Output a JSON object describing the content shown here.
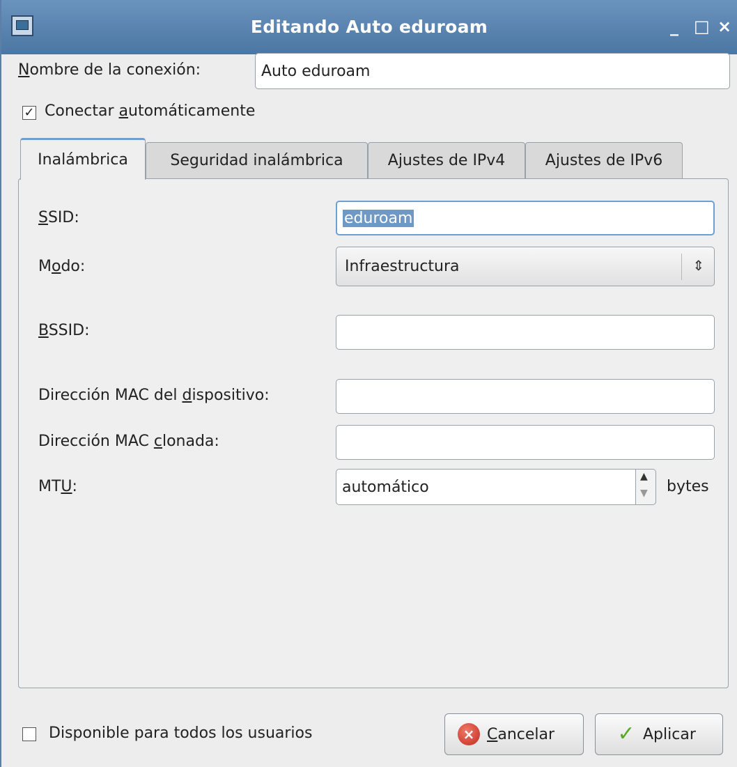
{
  "window": {
    "title": "Editando Auto eduroam",
    "minimize": "_",
    "maximize": "□",
    "close": "×"
  },
  "connection_name": {
    "label_mnemonic": "N",
    "label_rest": "ombre de la conexión:",
    "value": "Auto eduroam"
  },
  "auto_connect": {
    "checked": "✓",
    "label_pre": "Conectar ",
    "label_mnemonic": "a",
    "label_post": "utomáticamente"
  },
  "tabs": [
    {
      "label": "Inalámbrica"
    },
    {
      "label": "Seguridad inalámbrica"
    },
    {
      "label": "Ajustes de IPv4"
    },
    {
      "label": "Ajustes de IPv6"
    }
  ],
  "wireless": {
    "ssid": {
      "label_mnemonic": "S",
      "label_rest": "SID:",
      "value": "eduroam"
    },
    "mode": {
      "label_pre": "M",
      "label_mnemonic": "o",
      "label_post": "do:",
      "value": "Infraestructura"
    },
    "bssid": {
      "label_mnemonic": "B",
      "label_rest": "SSID:",
      "value": ""
    },
    "mac": {
      "label_pre": "Dirección MAC del ",
      "label_mnemonic": "d",
      "label_post": "ispositivo:",
      "value": ""
    },
    "cloned_mac": {
      "label_pre": "Dirección MAC ",
      "label_mnemonic": "c",
      "label_post": "lonada:",
      "value": ""
    },
    "mtu": {
      "label_pre": "MT",
      "label_mnemonic": "U",
      "label_post": ":",
      "value": "automático",
      "unit": "bytes"
    }
  },
  "footer": {
    "all_users_label": "Disponible para todos los usuarios",
    "cancel_mnemonic": "C",
    "cancel_rest": "ancelar",
    "apply_label": "Aplicar"
  }
}
